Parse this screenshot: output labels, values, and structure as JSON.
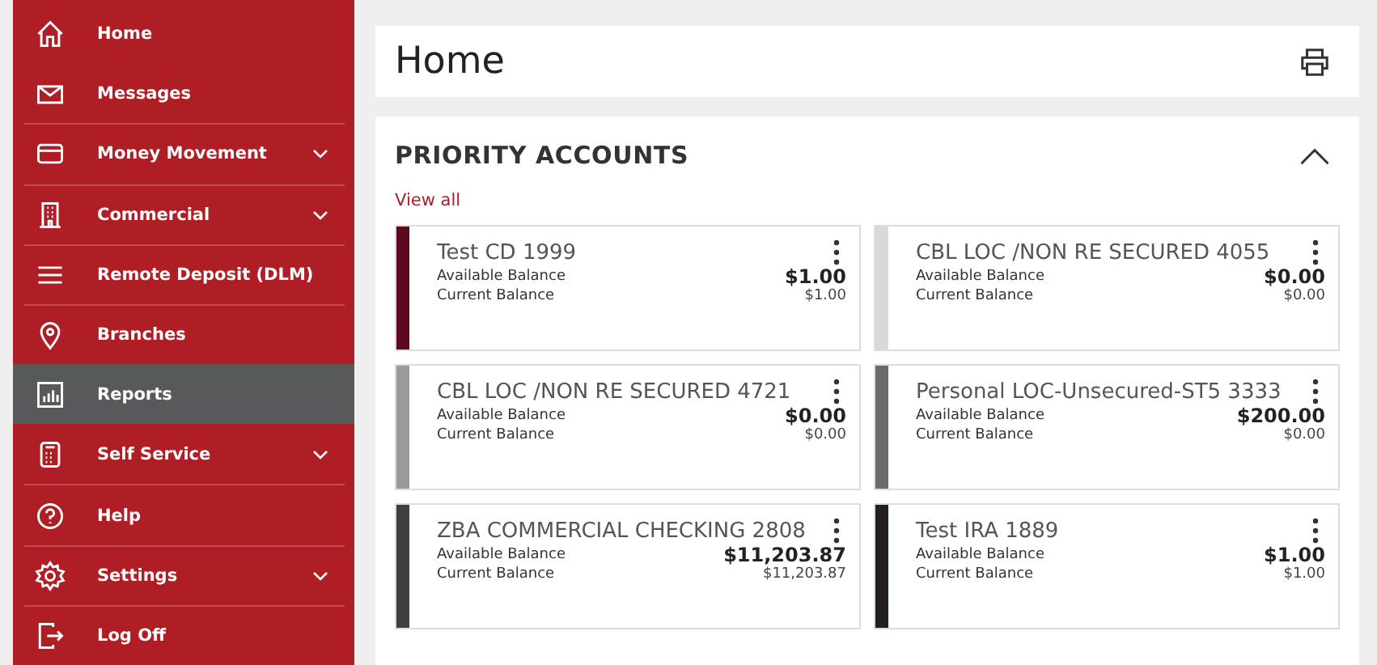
{
  "sidebar": {
    "items": [
      {
        "label": "Home",
        "selected": false,
        "expandable": false
      },
      {
        "label": "Messages",
        "selected": false,
        "expandable": false
      },
      {
        "label": "Money Movement",
        "selected": false,
        "expandable": true
      },
      {
        "label": "Commercial",
        "selected": false,
        "expandable": true
      },
      {
        "label": "Remote Deposit (DLM)",
        "selected": false,
        "expandable": false
      },
      {
        "label": "Branches",
        "selected": false,
        "expandable": false
      },
      {
        "label": "Reports",
        "selected": true,
        "expandable": false
      },
      {
        "label": "Self Service",
        "selected": false,
        "expandable": true
      },
      {
        "label": "Help",
        "selected": false,
        "expandable": false
      },
      {
        "label": "Settings",
        "selected": false,
        "expandable": true
      },
      {
        "label": "Log Off",
        "selected": false,
        "expandable": false
      }
    ]
  },
  "header": {
    "title": "Home"
  },
  "panel": {
    "title": "PRIORITY ACCOUNTS",
    "expanded": true,
    "link": "View all",
    "accounts": [
      {
        "name": "Test CD 1999",
        "color": "#5c0a1e",
        "available_label": "Available Balance",
        "available": "$1.00",
        "current_label": "Current Balance",
        "current": "$1.00"
      },
      {
        "name": "CBL LOC /NON RE SECURED 4055",
        "color": "#d9d9d9",
        "available_label": "Available Balance",
        "available": "$0.00",
        "current_label": "Current Balance",
        "current": "$0.00"
      },
      {
        "name": "CBL LOC /NON RE SECURED 4721",
        "color": "#9a9a9c",
        "available_label": "Available Balance",
        "available": "$0.00",
        "current_label": "Current Balance",
        "current": "$0.00"
      },
      {
        "name": "Personal LOC-Unsecured-ST5 3333",
        "color": "#6a6b6d",
        "available_label": "Available Balance",
        "available": "$200.00",
        "current_label": "Current Balance",
        "current": "$0.00"
      },
      {
        "name": "ZBA COMMERCIAL CHECKING 2808",
        "color": "#3f3f3f",
        "available_label": "Available Balance",
        "available": "$11,203.87",
        "current_label": "Current Balance",
        "current": "$11,203.87"
      },
      {
        "name": "Test IRA 1889",
        "color": "#231f20",
        "available_label": "Available Balance",
        "available": "$1.00",
        "current_label": "Current Balance",
        "current": "$1.00"
      }
    ]
  }
}
